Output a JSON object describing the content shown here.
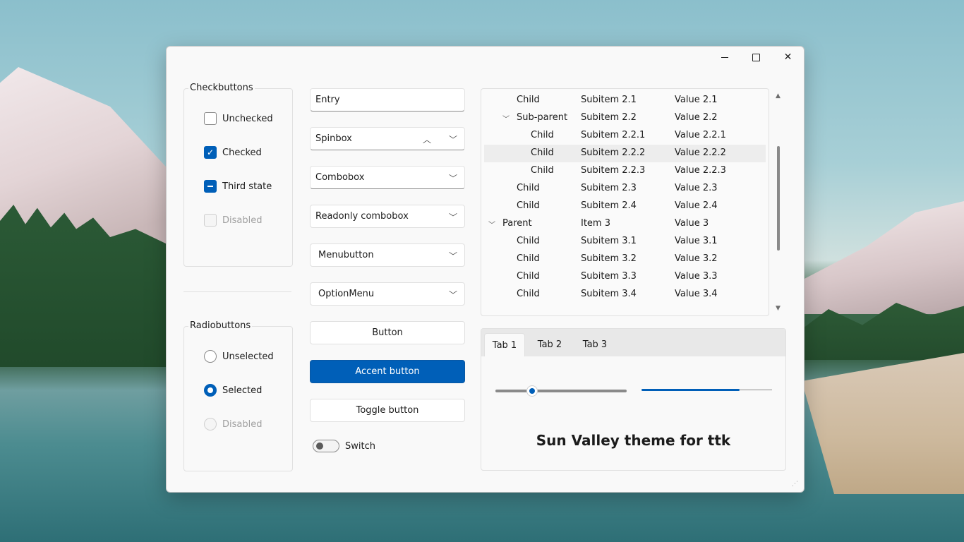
{
  "window": {
    "controls": {
      "minimize": "minimize",
      "maximize": "maximize",
      "close": "close"
    }
  },
  "checkbuttons": {
    "title": "Checkbuttons",
    "items": [
      {
        "label": "Unchecked",
        "state": "unchecked"
      },
      {
        "label": "Checked",
        "state": "checked"
      },
      {
        "label": "Third state",
        "state": "indeterminate"
      },
      {
        "label": "Disabled",
        "state": "disabled"
      }
    ]
  },
  "radiobuttons": {
    "title": "Radiobuttons",
    "items": [
      {
        "label": "Unselected",
        "state": "unselected"
      },
      {
        "label": "Selected",
        "state": "selected"
      },
      {
        "label": "Disabled",
        "state": "disabled"
      }
    ]
  },
  "widgets": {
    "entry_value": "Entry",
    "spinbox_value": "Spinbox",
    "combobox_value": "Combobox",
    "readonly_combobox_value": "Readonly combobox",
    "menubutton_label": "Menubutton",
    "optionmenu_label": "OptionMenu",
    "button_label": "Button",
    "accent_button_label": "Accent button",
    "toggle_button_label": "Toggle button",
    "switch_label": "Switch",
    "switch_on": false
  },
  "treeview": {
    "rows": [
      {
        "name": "Child",
        "sub": "Subitem 2.1",
        "value": "Value 2.1",
        "selected": false
      },
      {
        "name": "Sub-parent",
        "sub": "Subitem 2.2",
        "value": "Value 2.2",
        "selected": false
      },
      {
        "name": "Child",
        "sub": "Subitem 2.2.1",
        "value": "Value 2.2.1",
        "selected": false
      },
      {
        "name": "Child",
        "sub": "Subitem 2.2.2",
        "value": "Value 2.2.2",
        "selected": true
      },
      {
        "name": "Child",
        "sub": "Subitem 2.2.3",
        "value": "Value 2.2.3",
        "selected": false
      },
      {
        "name": "Child",
        "sub": "Subitem 2.3",
        "value": "Value 2.3",
        "selected": false
      },
      {
        "name": "Child",
        "sub": "Subitem 2.4",
        "value": "Value 2.4",
        "selected": false
      },
      {
        "name": "Parent",
        "sub": "Item 3",
        "value": "Value 3",
        "selected": false
      },
      {
        "name": "Child",
        "sub": "Subitem 3.1",
        "value": "Value 3.1",
        "selected": false
      },
      {
        "name": "Child",
        "sub": "Subitem 3.2",
        "value": "Value 3.2",
        "selected": false
      },
      {
        "name": "Child",
        "sub": "Subitem 3.3",
        "value": "Value 3.3",
        "selected": false
      },
      {
        "name": "Child",
        "sub": "Subitem 3.4",
        "value": "Value 3.4",
        "selected": false
      }
    ]
  },
  "notebook": {
    "tabs": [
      {
        "label": "Tab 1",
        "active": true
      },
      {
        "label": "Tab 2",
        "active": false
      },
      {
        "label": "Tab 3",
        "active": false
      }
    ],
    "scale_value_fraction": 0.28,
    "progress_fraction": 0.75,
    "label": "Sun Valley theme for ttk"
  },
  "colors": {
    "accent": "#005fb8",
    "window_bg": "#f9f9f9",
    "border": "#e0e0e0"
  }
}
